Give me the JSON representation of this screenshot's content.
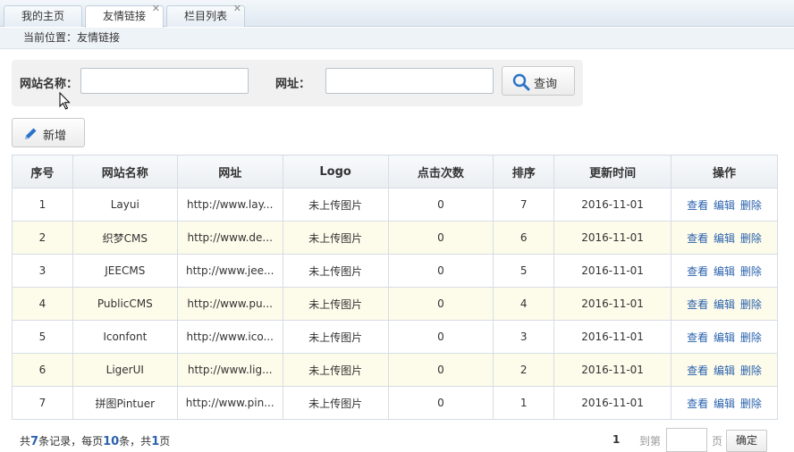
{
  "tabs": [
    {
      "label": "我的主页",
      "closable": false,
      "active": false
    },
    {
      "label": "友情链接",
      "closable": true,
      "active": true
    },
    {
      "label": "栏目列表",
      "closable": true,
      "active": false
    }
  ],
  "close_glyph": "✕",
  "breadcrumb": "当前位置：友情链接",
  "search": {
    "name_label": "网站名称：",
    "name_value": "",
    "url_label": "网址：",
    "url_value": "",
    "query_label": "查询"
  },
  "toolbar": {
    "add_label": "新增"
  },
  "table": {
    "headers": [
      "序号",
      "网站名称",
      "网址",
      "Logo",
      "点击次数",
      "排序",
      "更新时间",
      "操作"
    ],
    "rows": [
      {
        "id": "1",
        "name": "Layui",
        "url": "http://www.lay...",
        "logo": "未上传图片",
        "clicks": "0",
        "sort": "7",
        "updated": "2016-11-01"
      },
      {
        "id": "2",
        "name": "织梦CMS",
        "url": "http://www.de...",
        "logo": "未上传图片",
        "clicks": "0",
        "sort": "6",
        "updated": "2016-11-01"
      },
      {
        "id": "3",
        "name": "JEECMS",
        "url": "http://www.jee...",
        "logo": "未上传图片",
        "clicks": "0",
        "sort": "5",
        "updated": "2016-11-01"
      },
      {
        "id": "4",
        "name": "PublicCMS",
        "url": "http://www.pu...",
        "logo": "未上传图片",
        "clicks": "0",
        "sort": "4",
        "updated": "2016-11-01"
      },
      {
        "id": "5",
        "name": "Iconfont",
        "url": "http://www.ico...",
        "logo": "未上传图片",
        "clicks": "0",
        "sort": "3",
        "updated": "2016-11-01"
      },
      {
        "id": "6",
        "name": "LigerUI",
        "url": "http://www.lig...",
        "logo": "未上传图片",
        "clicks": "0",
        "sort": "2",
        "updated": "2016-11-01"
      },
      {
        "id": "7",
        "name": "拼图Pintuer",
        "url": "http://www.pin...",
        "logo": "未上传图片",
        "clicks": "0",
        "sort": "1",
        "updated": "2016-11-01"
      }
    ],
    "ops": {
      "view": "查看",
      "edit": "编辑",
      "delete": "删除"
    }
  },
  "pager": {
    "summary_prefix": "共",
    "total": "7",
    "summary_mid1": "条记录，每页",
    "per_page": "10",
    "summary_mid2": "条，共",
    "pages": "1",
    "summary_suffix": "页",
    "current_page": "1",
    "goto_label": "到第",
    "goto_value": "",
    "page_unit": "页",
    "confirm_label": "确定"
  },
  "colors": {
    "accent": "#2a62ad",
    "alt_row": "#fdfbea",
    "tabbar": "#dfe8f1"
  },
  "icons": {
    "search": "search-icon",
    "add": "pencil-icon",
    "close": "close-icon",
    "cursor": "mouse-pointer-icon"
  }
}
